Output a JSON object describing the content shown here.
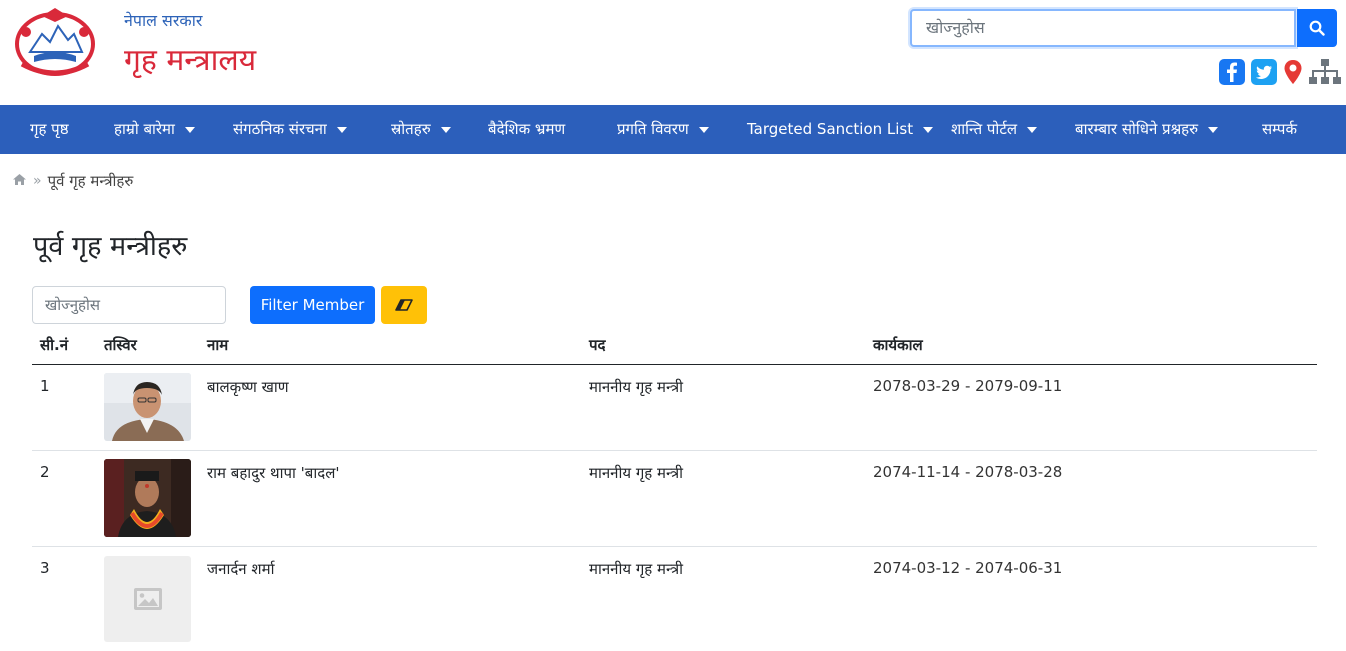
{
  "header": {
    "org_sub": "नेपाल सरकार",
    "org_main": "गृह मन्त्रालय",
    "search_placeholder": "खोज्नुहोस",
    "social_icons": [
      "facebook-icon",
      "twitter-icon",
      "location-pin-icon",
      "sitemap-icon"
    ]
  },
  "nav": {
    "items": [
      {
        "label": "गृह पृष्ठ",
        "dropdown": false
      },
      {
        "label": "हाम्रो बारेमा",
        "dropdown": true
      },
      {
        "label": "संगठनिक संरचना",
        "dropdown": true
      },
      {
        "label": "स्रोतहरु",
        "dropdown": true
      },
      {
        "label": "बैदेशिक भ्रमण",
        "dropdown": false
      },
      {
        "label": "प्रगति विवरण",
        "dropdown": true
      },
      {
        "label": "Targeted Sanction List",
        "dropdown": true
      },
      {
        "label": "शान्ति पोर्टल",
        "dropdown": true
      },
      {
        "label": "बारम्बार सोधिने प्रश्नहरु",
        "dropdown": true
      },
      {
        "label": "सम्पर्क",
        "dropdown": false
      }
    ]
  },
  "breadcrumb": {
    "current": "पूर्व गृह मन्त्रीहरु"
  },
  "page": {
    "title": "पूर्व गृह मन्त्रीहरु",
    "filter_placeholder": "खोज्नुहोस",
    "filter_button": "Filter Member",
    "clear_icon": "eraser-icon"
  },
  "table": {
    "headers": {
      "sn": "सी.नं",
      "photo": "तस्विर",
      "name": "नाम",
      "post": "पद",
      "tenure": "कार्यकाल"
    },
    "rows": [
      {
        "sn": "1",
        "name": "बालकृष्ण खाण",
        "post": "माननीय गृह मन्त्री",
        "tenure": "2078-03-29 - 2079-09-11",
        "photo": "portrait"
      },
      {
        "sn": "2",
        "name": "राम बहादुर थापा 'बादल'",
        "post": "माननीय गृह मन्त्री",
        "tenure": "2074-11-14 - 2078-03-28",
        "photo": "portrait"
      },
      {
        "sn": "3",
        "name": "जनार्दन शर्मा",
        "post": "माननीय गृह मन्त्री",
        "tenure": "2074-03-12 - 2074-06-31",
        "photo": "image-placeholder-icon"
      }
    ]
  },
  "colors": {
    "nav_bg": "#2c5fbb",
    "brand_red": "#d9293a",
    "primary": "#0d6efd",
    "warning": "#ffc107"
  }
}
